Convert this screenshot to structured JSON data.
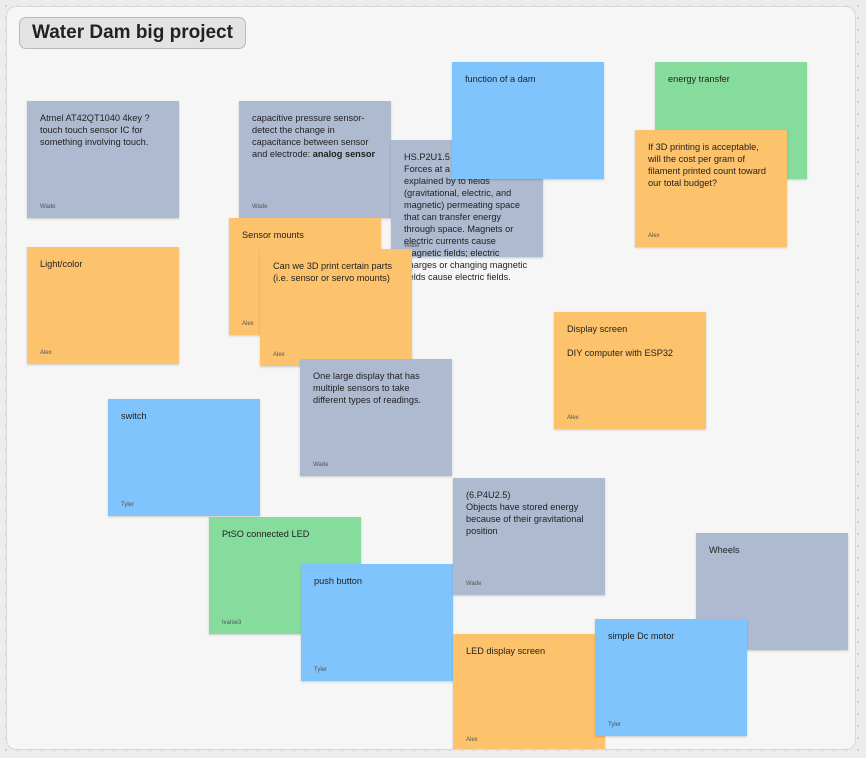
{
  "board": {
    "title": "Water Dam big project"
  },
  "notes": {
    "function_of_dam": {
      "text": "function of a dam",
      "author": "",
      "color": "#7fc4fc"
    },
    "energy_transfer": {
      "text": "energy transfer",
      "author": "",
      "color": "#86dc9d"
    },
    "atmel_sensor": {
      "text": "Atmel AT42QT1040 4key ?touch touch sensor IC for something involving touch.",
      "author": "Wade",
      "color": "#aebad0"
    },
    "capacitive_sensor": {
      "text": "capacitive pressure sensor- detect the change in capacitance between sensor and electrode:",
      "bold": "analog sensor",
      "author": "Wade",
      "color": "#aebad0"
    },
    "hs_p2u1_5": {
      "text": "HS.P2U1.5\nForces at a distance are explained by to fields (gravitational, electric, and magnetic) permeating space that can transfer energy through space. Magnets or electric currents cause magnetic fields; electric charges or changing magnetic fields cause electric fields.",
      "author": "Wade",
      "color": "#aebad0"
    },
    "filament_cost": {
      "text": "If 3D printing is acceptable, will the cost per gram of filament printed count toward our total budget?",
      "author": "Alex",
      "color": "#fdc36c"
    },
    "sensor_mounts": {
      "text": "Sensor mounts",
      "author": "Alex",
      "color": "#fdc36c"
    },
    "light_color": {
      "text": "Light/color",
      "author": "Alex",
      "color": "#fdc36c"
    },
    "print_parts": {
      "text": "Can we 3D print certain parts (i.e. sensor or servo mounts)",
      "author": "Alex",
      "color": "#fdc36c"
    },
    "display_screen": {
      "text": "Display screen\n\nDIY computer with ESP32",
      "author": "Alex",
      "color": "#fdc36c"
    },
    "large_display": {
      "text": "One large display that has multiple sensors to take different types of readings.",
      "author": "Wade",
      "color": "#aebad0"
    },
    "switch": {
      "text": "switch",
      "author": "Tyler",
      "color": "#7fc4fc"
    },
    "stored_energy": {
      "text": "(6.P4U2.5)\nObjects have stored energy because of their gravitational position",
      "author": "Wade",
      "color": "#aebad0"
    },
    "wheels": {
      "text": "Wheels",
      "author": "",
      "color": "#aebad0"
    },
    "ptso_led": {
      "text": "PtSO connected LED",
      "author": "Ivanie3",
      "color": "#86dc9d"
    },
    "push_button": {
      "text": "push button",
      "author": "Tyler",
      "color": "#7fc4fc"
    },
    "led_display": {
      "text": "LED display screen",
      "author": "Alex",
      "color": "#fdc36c"
    },
    "dc_motor": {
      "text": "simple Dc motor",
      "author": "Tyler",
      "color": "#7fc4fc"
    }
  }
}
